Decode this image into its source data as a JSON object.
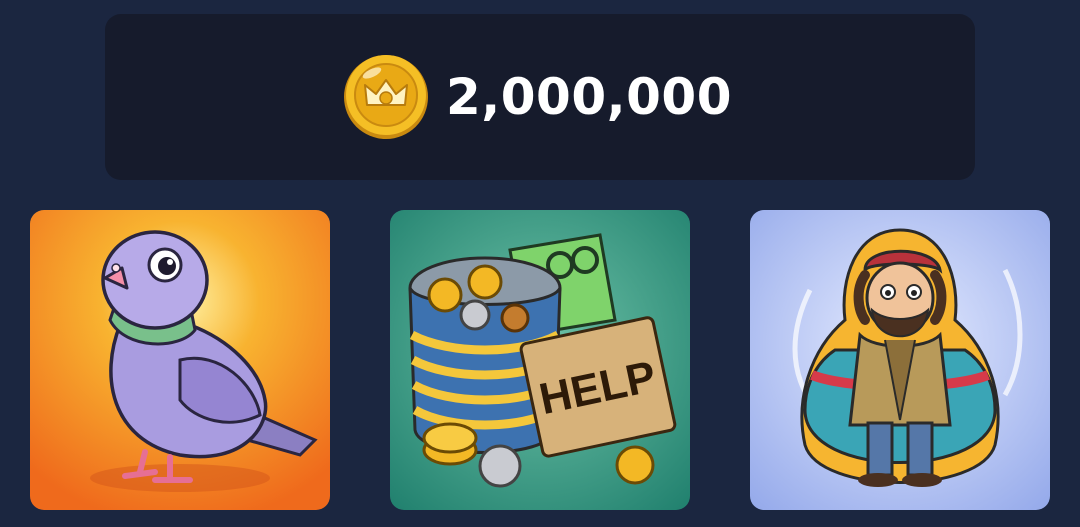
{
  "balance": {
    "icon": "crown-coin-icon",
    "value": "2,000,000"
  },
  "cards": [
    {
      "icon": "pigeon-icon",
      "bg": "#f08a1c"
    },
    {
      "icon": "tin-can-help-icon",
      "bg": "#2f9c84",
      "sign_text": "HELP"
    },
    {
      "icon": "homeless-doll-icon",
      "bg": "#9fb4ef"
    }
  ],
  "colors": {
    "page_bg": "#1b2640",
    "panel_bg": "#161b2c",
    "coin": "#f2b51d"
  }
}
